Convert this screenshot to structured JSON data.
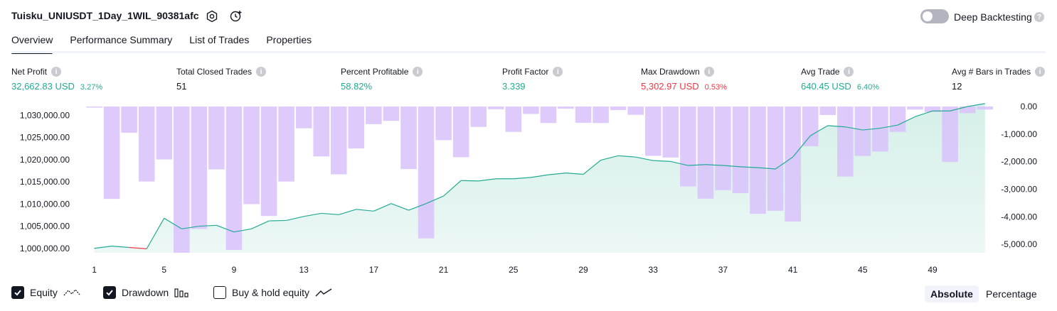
{
  "header": {
    "title": "Tuisku_UNIUSDT_1Day_1WIL_90381afc",
    "deep_backtesting_label": "Deep Backtesting",
    "deep_backtesting_on": false
  },
  "tabs": [
    {
      "label": "Overview",
      "active": true
    },
    {
      "label": "Performance Summary",
      "active": false
    },
    {
      "label": "List of Trades",
      "active": false
    },
    {
      "label": "Properties",
      "active": false
    }
  ],
  "metrics": [
    {
      "label": "Net Profit",
      "value": "32,662.83 USD",
      "pct": "3.27%",
      "color": "#22ab94"
    },
    {
      "label": "Total Closed Trades",
      "value": "51",
      "pct": "",
      "color": "#131722"
    },
    {
      "label": "Percent Profitable",
      "value": "58.82%",
      "pct": "",
      "color": "#22ab94"
    },
    {
      "label": "Profit Factor",
      "value": "3.339",
      "pct": "",
      "color": "#22ab94"
    },
    {
      "label": "Max Drawdown",
      "value": "5,302.97 USD",
      "pct": "0.53%",
      "color": "#f23645"
    },
    {
      "label": "Avg Trade",
      "value": "640.45 USD",
      "pct": "6.40%",
      "color": "#22ab94"
    },
    {
      "label": "Avg # Bars in Trades",
      "value": "12",
      "pct": "",
      "color": "#131722"
    }
  ],
  "legend": {
    "equity": {
      "label": "Equity",
      "checked": true
    },
    "drawdown": {
      "label": "Drawdown",
      "checked": true
    },
    "buy_hold": {
      "label": "Buy & hold equity",
      "checked": false
    }
  },
  "view_toggle": {
    "absolute": "Absolute",
    "percentage": "Percentage",
    "selected": "Absolute"
  },
  "colors": {
    "equity_line": "#22ab94",
    "equity_fill": "#d5efe9",
    "drawdown_bar": "#d8c2fb",
    "loss_line": "#f23645"
  },
  "chart_data": {
    "type": "area",
    "x_tick_labels": [
      "1",
      "5",
      "9",
      "13",
      "17",
      "21",
      "25",
      "29",
      "33",
      "37",
      "41",
      "45",
      "49"
    ],
    "x_range": [
      0,
      52.5
    ],
    "left_axis": {
      "ticks": [
        "1,000,000.00",
        "1,005,000.00",
        "1,010,000.00",
        "1,015,000.00",
        "1,020,000.00",
        "1,025,000.00",
        "1,030,000.00"
      ],
      "ylim": [
        999000,
        1032000
      ]
    },
    "right_axis": {
      "ticks": [
        "0.00",
        "-1,000.00",
        "-2,000.00",
        "-3,000.00",
        "-4,000.00",
        "-5,000.00"
      ],
      "ylim": [
        -5302.97,
        0
      ]
    },
    "series": [
      {
        "name": "Equity",
        "axis": "left",
        "x": [
          1,
          2,
          3,
          4,
          5,
          6,
          7,
          8,
          9,
          10,
          11,
          12,
          13,
          14,
          15,
          16,
          17,
          18,
          19,
          20,
          21,
          22,
          23,
          24,
          25,
          26,
          27,
          28,
          29,
          30,
          31,
          32,
          33,
          34,
          35,
          36,
          37,
          38,
          39,
          40,
          41,
          42,
          43,
          44,
          45,
          46,
          47,
          48,
          49,
          50,
          51,
          52
        ],
        "values": [
          1000000,
          1000500,
          1000200,
          999900,
          1006800,
          1004400,
          1005000,
          1005200,
          1003700,
          1004400,
          1006200,
          1006300,
          1007200,
          1007900,
          1007600,
          1008800,
          1008400,
          1010100,
          1008600,
          1010100,
          1011800,
          1015300,
          1015200,
          1015700,
          1015700,
          1016000,
          1016600,
          1017000,
          1016700,
          1019900,
          1020900,
          1020600,
          1019800,
          1019600,
          1018700,
          1018900,
          1018700,
          1018400,
          1018200,
          1017900,
          1020600,
          1025400,
          1027700,
          1027400,
          1026700,
          1027100,
          1027800,
          1029700,
          1031000,
          1031000,
          1032000,
          1032662.83
        ]
      },
      {
        "name": "Drawdown",
        "axis": "right",
        "x": [
          1,
          2,
          3,
          4,
          5,
          6,
          7,
          8,
          9,
          10,
          11,
          12,
          13,
          14,
          15,
          16,
          17,
          18,
          19,
          20,
          21,
          22,
          23,
          24,
          25,
          26,
          27,
          28,
          29,
          30,
          31,
          32,
          33,
          34,
          35,
          36,
          37,
          38,
          39,
          40,
          41,
          42,
          43,
          44,
          45,
          46,
          47,
          48,
          49,
          50,
          51,
          52
        ],
        "values": [
          -40,
          -3350,
          -950,
          -2720,
          -1920,
          -5300,
          -4440,
          -2280,
          -5200,
          -3540,
          -3970,
          -2720,
          -790,
          -1810,
          -2460,
          -1520,
          -640,
          -520,
          -2270,
          -4780,
          -1220,
          -1840,
          -740,
          -100,
          -920,
          -270,
          -600,
          -80,
          -590,
          -600,
          -130,
          -300,
          -1790,
          -1850,
          -2900,
          -3340,
          -3030,
          -3140,
          -3890,
          -3780,
          -4170,
          -1440,
          -310,
          -2540,
          -1790,
          -1630,
          -920,
          -110,
          -200,
          -2010,
          -240,
          -110
        ]
      }
    ]
  }
}
